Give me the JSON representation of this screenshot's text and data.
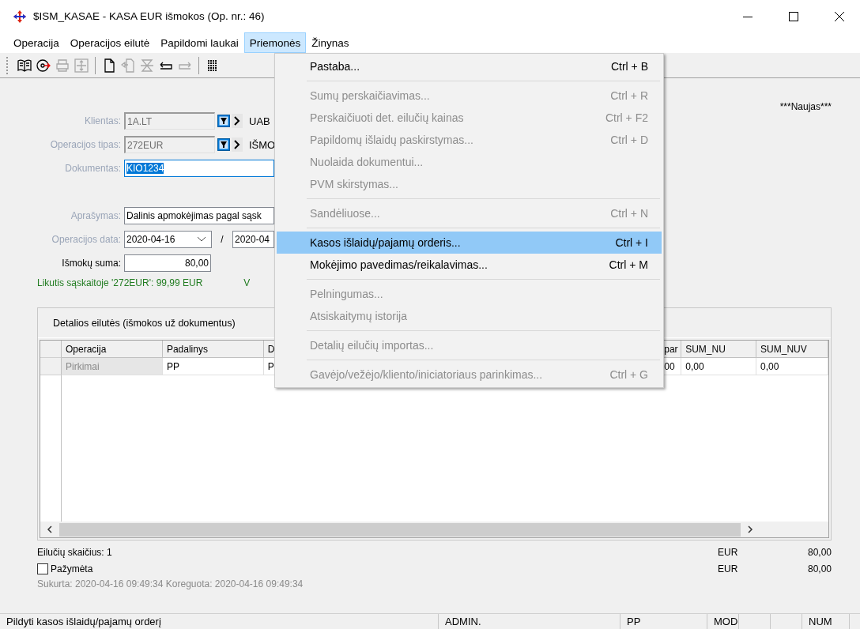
{
  "window": {
    "title": "$ISM_KASAE - KASA EUR išmokos (Op. nr.: 46)"
  },
  "menubar": [
    {
      "label": "Operacija",
      "selected": false
    },
    {
      "label": "Operacijos eilutė",
      "selected": false
    },
    {
      "label": "Papildomi laukai",
      "selected": false
    },
    {
      "label": "Priemonės",
      "selected": true
    },
    {
      "label": "Žinynas",
      "selected": false
    }
  ],
  "toolbar": [
    [
      {
        "disabled": false
      },
      {
        "disabled": false
      },
      {
        "disabled": true
      },
      {
        "disabled": true
      }
    ],
    [
      {
        "disabled": false
      },
      {
        "disabled": true
      },
      {
        "disabled": true
      },
      {
        "disabled": false
      },
      {
        "disabled": true
      }
    ],
    [
      {
        "disabled": false
      }
    ]
  ],
  "record_state": "***Naujas***",
  "form": {
    "fields": [
      {
        "label": "Klientas:",
        "value": "1A.LT",
        "kind": "lookup",
        "dimmed": true,
        "disabled": true,
        "extra": "UAB"
      },
      {
        "label": "Operacijos tipas:",
        "value": "272EUR",
        "kind": "lookup",
        "dimmed": true,
        "disabled": true,
        "extra": "IŠMO"
      },
      {
        "label": "Dokumentas:",
        "value": "KIO1234",
        "kind": "text",
        "dimmed": true,
        "focused": true
      },
      {
        "label": "Aprašymas:",
        "value": "Dalinis apmokėjimas pagal sąsk",
        "kind": "text",
        "dimmed": true,
        "focused": false
      },
      {
        "label": "Operacijos data:",
        "value": "2020-04-16",
        "kind": "date",
        "dimmed": true,
        "separator": "/",
        "value2": "2020-04"
      },
      {
        "label": "Išmokų suma:",
        "value": "80,00",
        "kind": "amount",
        "dimmed": false
      }
    ],
    "balance": "Likutis sąskaitoje '272EUR': 99,99 EUR",
    "balance_extra": "V"
  },
  "details": {
    "title": "Detalios eilutės (išmokos už dokumentus)",
    "columns": [
      {
        "label": "Operacija",
        "readonly": true
      },
      {
        "label": "Padalinys",
        "readonly": false
      },
      {
        "label": "D",
        "readonly": false
      },
      {
        "label": "par",
        "readonly": false
      },
      {
        "label": "SUM_NU",
        "readonly": false
      },
      {
        "label": "SUM_NUV",
        "readonly": false
      }
    ],
    "rows": [
      [
        "Pirkimai",
        "PP",
        "P",
        "00",
        "0,00",
        "0,00"
      ]
    ]
  },
  "footer": {
    "row_count": "Eilučių skaičius: 1",
    "total_currency": "EUR",
    "total": "80,00",
    "marked_label": "Pažymėta",
    "marked_checked": false,
    "marked_currency": "EUR",
    "marked_total": "80,00",
    "audit": "Sukurta: 2020-04-16 09:49:34 Koreguota: 2020-04-16 09:49:34"
  },
  "menu": [
    {
      "kind": "item",
      "label": "Pastaba...",
      "shortcut": "Ctrl + B",
      "disabled": false,
      "selected": false
    },
    {
      "kind": "separator"
    },
    {
      "kind": "item",
      "label": "Sumų perskaičiavimas...",
      "shortcut": "Ctrl + R",
      "disabled": true,
      "selected": false
    },
    {
      "kind": "item",
      "label": "Perskaičiuoti det. eilučių kainas",
      "shortcut": "Ctrl + F2",
      "disabled": true,
      "selected": false
    },
    {
      "kind": "item",
      "label": "Papildomų išlaidų paskirstymas...",
      "shortcut": "Ctrl + D",
      "disabled": true,
      "selected": false
    },
    {
      "kind": "item",
      "label": "Nuolaida dokumentui...",
      "disabled": true,
      "selected": false
    },
    {
      "kind": "item",
      "label": "PVM skirstymas...",
      "disabled": true,
      "selected": false
    },
    {
      "kind": "separator"
    },
    {
      "kind": "item",
      "label": "Sandėliuose...",
      "shortcut": "Ctrl + N",
      "disabled": true,
      "selected": false
    },
    {
      "kind": "separator"
    },
    {
      "kind": "item",
      "label": "Kasos išlaidų/pajamų orderis...",
      "shortcut": "Ctrl + I",
      "disabled": false,
      "selected": true
    },
    {
      "kind": "item",
      "label": "Mokėjimo pavedimas/reikalavimas...",
      "shortcut": "Ctrl + M",
      "disabled": false,
      "selected": false
    },
    {
      "kind": "separator"
    },
    {
      "kind": "item",
      "label": "Pelningumas...",
      "disabled": true,
      "selected": false
    },
    {
      "kind": "item",
      "label": "Atsiskaitymų istorija",
      "disabled": true,
      "selected": false
    },
    {
      "kind": "separator"
    },
    {
      "kind": "item",
      "label": "Detalių eilučių importas...",
      "disabled": true,
      "selected": false
    },
    {
      "kind": "separator"
    },
    {
      "kind": "item",
      "label": "Gavėjo/vežėjo/kliento/iniciatoriaus parinkimas...",
      "shortcut": "Ctrl + G",
      "disabled": true,
      "selected": false
    }
  ],
  "status_bar": [
    "Pildyti kasos išlaidų/pajamų orderį",
    "ADMIN.",
    "PP",
    "MOD",
    "NUM"
  ]
}
